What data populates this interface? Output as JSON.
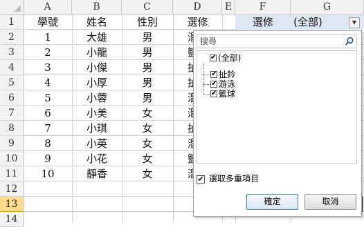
{
  "columns": [
    "A",
    "B",
    "C",
    "D",
    "E",
    "F",
    "G"
  ],
  "rows": [
    "1",
    "2",
    "3",
    "4",
    "5",
    "6",
    "7",
    "8",
    "9",
    "10",
    "11",
    "12",
    "13",
    "14"
  ],
  "header_row": {
    "A": "學號",
    "B": "姓名",
    "C": "性別",
    "D": "選修",
    "F": "選修",
    "G": "(全部)"
  },
  "table": [
    {
      "id": "1",
      "name": "大雄",
      "gender": "男",
      "course": "溜"
    },
    {
      "id": "2",
      "name": "小龍",
      "gender": "男",
      "course": "籃"
    },
    {
      "id": "3",
      "name": "小傑",
      "gender": "男",
      "course": "扯"
    },
    {
      "id": "4",
      "name": "小厚",
      "gender": "男",
      "course": "扯"
    },
    {
      "id": "5",
      "name": "小蓉",
      "gender": "男",
      "course": "溜"
    },
    {
      "id": "6",
      "name": "小美",
      "gender": "女",
      "course": "溜"
    },
    {
      "id": "7",
      "name": "小琪",
      "gender": "女",
      "course": "扯"
    },
    {
      "id": "8",
      "name": "小英",
      "gender": "女",
      "course": "溜"
    },
    {
      "id": "9",
      "name": "小花",
      "gender": "女",
      "course": "籃"
    },
    {
      "id": "10",
      "name": "靜香",
      "gender": "女",
      "course": "溜"
    }
  ],
  "filter_button": "▼",
  "dropdown": {
    "search_placeholder": "搜尋",
    "items": [
      {
        "label": "(全部)",
        "checked": true
      },
      {
        "label": "扯鈴",
        "checked": true
      },
      {
        "label": "游泳",
        "checked": true
      },
      {
        "label": "籃球",
        "checked": true
      }
    ],
    "multi_select_label": "選取多重項目",
    "multi_select_checked": true,
    "ok_label": "確定",
    "cancel_label": "取消"
  },
  "check_glyph": "✔",
  "selected_row": "13",
  "colors": {
    "header_bg": "#f2f2f2",
    "selected_row": "#ffd98c",
    "filter_cell": "#dde6f2",
    "grid": "#d4d4d4"
  }
}
